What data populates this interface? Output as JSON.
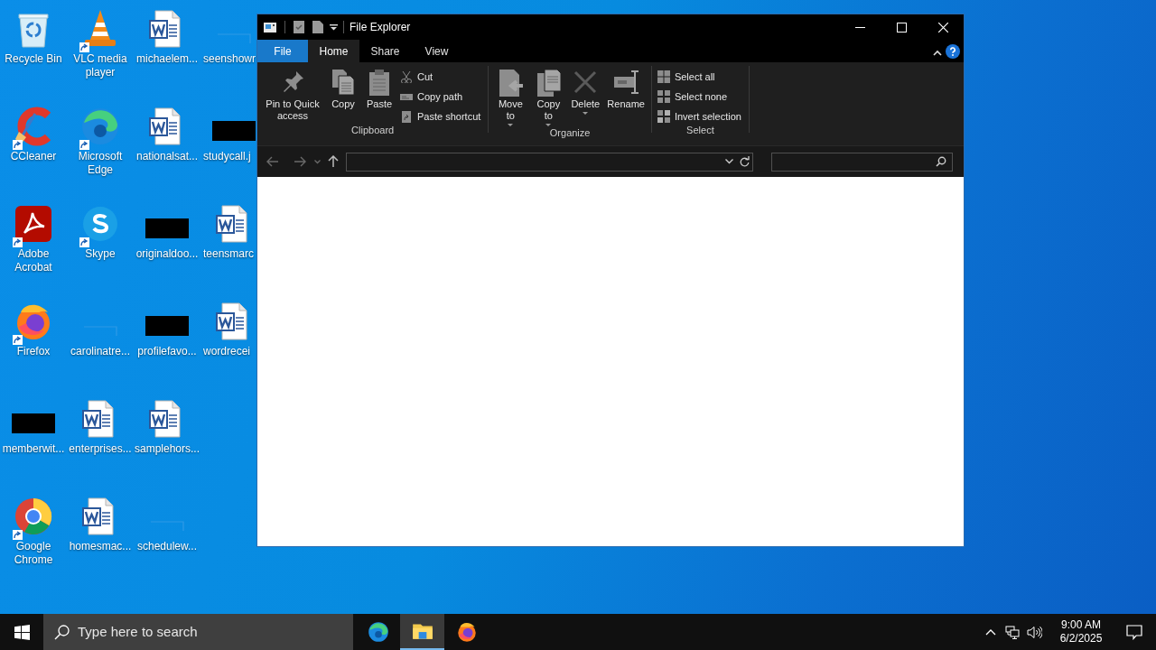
{
  "desktop": {
    "icons": [
      {
        "label": "Recycle Bin",
        "kind": "recycle",
        "shortcut": false
      },
      {
        "label": "CCleaner",
        "kind": "ccleaner",
        "shortcut": true
      },
      {
        "label": "Adobe Acrobat",
        "kind": "acrobat",
        "shortcut": true
      },
      {
        "label": "Firefox",
        "kind": "firefox",
        "shortcut": true
      },
      {
        "label": "memberwit...",
        "kind": "dark-thumbnail",
        "shortcut": false
      },
      {
        "label": "Google Chrome",
        "kind": "chrome",
        "shortcut": true
      },
      {
        "label": "VLC media player",
        "kind": "vlc",
        "shortcut": true
      },
      {
        "label": "Microsoft Edge",
        "kind": "edge",
        "shortcut": true
      },
      {
        "label": "Skype",
        "kind": "skype",
        "shortcut": true
      },
      {
        "label": "carolinatre...",
        "kind": "blank-thumbnail",
        "shortcut": false
      },
      {
        "label": "enterprises...",
        "kind": "word",
        "shortcut": false
      },
      {
        "label": "homesmac...",
        "kind": "word",
        "shortcut": false
      },
      {
        "label": "michaelem...",
        "kind": "word",
        "shortcut": false
      },
      {
        "label": "nationalsat...",
        "kind": "word",
        "shortcut": false
      },
      {
        "label": "originaldoo...",
        "kind": "dark-thumbnail",
        "shortcut": false
      },
      {
        "label": "profilefavo...",
        "kind": "dark-thumbnail",
        "shortcut": false
      },
      {
        "label": "samplehors...",
        "kind": "word",
        "shortcut": false
      },
      {
        "label": "schedulew...",
        "kind": "blank-thumbnail",
        "shortcut": false
      },
      {
        "label": "seenshowr",
        "kind": "blank-thumbnail",
        "shortcut": false
      },
      {
        "label": "studycall.j",
        "kind": "dark-thumbnail",
        "shortcut": false
      },
      {
        "label": "teensmarc",
        "kind": "word",
        "shortcut": false
      },
      {
        "label": "wordrecei",
        "kind": "word",
        "shortcut": false
      }
    ]
  },
  "window": {
    "title": "File Explorer",
    "tabs": [
      {
        "label": "File",
        "kind": "menu",
        "selected": false
      },
      {
        "label": "Home",
        "kind": "tab",
        "selected": true
      },
      {
        "label": "Share",
        "kind": "tab",
        "selected": false
      },
      {
        "label": "View",
        "kind": "tab",
        "selected": false
      }
    ],
    "ribbon": [
      {
        "label": "Clipboard",
        "large": [
          {
            "label": "Pin to Quick access",
            "dropdown": false
          },
          {
            "label": "Copy",
            "dropdown": false
          },
          {
            "label": "Paste",
            "dropdown": false
          }
        ],
        "small": [
          {
            "label": "Cut"
          },
          {
            "label": "Copy path"
          },
          {
            "label": "Paste shortcut"
          }
        ]
      },
      {
        "label": "Organize",
        "large": [
          {
            "label": "Move to",
            "dropdown": true
          },
          {
            "label": "Copy to",
            "dropdown": true
          },
          {
            "label": "Delete",
            "dropdown": true
          },
          {
            "label": "Rename",
            "dropdown": false
          }
        ]
      },
      {
        "label": "Select",
        "small": [
          {
            "label": "Select all"
          },
          {
            "label": "Select none"
          },
          {
            "label": "Invert selection"
          }
        ]
      }
    ]
  },
  "taskbar": {
    "search": {
      "placeholder": "Type here to search"
    },
    "apps": [
      {
        "kind": "edge",
        "active": false
      },
      {
        "kind": "explorer",
        "active": true
      },
      {
        "kind": "firefox",
        "active": false
      }
    ],
    "time": "9:00 AM",
    "date": "6/2/2025"
  }
}
